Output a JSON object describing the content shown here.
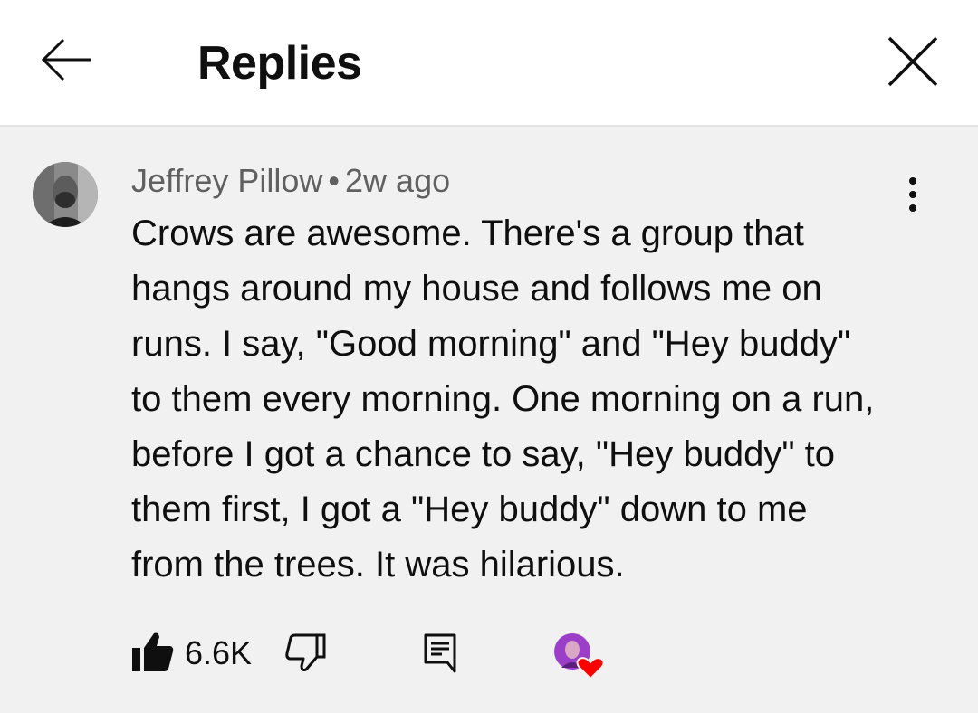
{
  "header": {
    "title": "Replies",
    "back_icon": "arrow-left-icon",
    "close_icon": "close-icon"
  },
  "comment": {
    "author": "Jeffrey Pillow",
    "separator": "•",
    "time": "2w ago",
    "text_lines": [
      "Crows are awesome. There's a group that",
      "hangs around my house and follows me on",
      "runs. I say, \"Good morning\" and \"Hey buddy\"",
      "to them every morning. One morning on a run,",
      "before I got a chance to say, \"Hey buddy\" to",
      "them first, I got a \"Hey buddy\" down to me",
      "from the trees. It was hilarious."
    ],
    "menu_icon": "more-vertical-icon"
  },
  "actions": {
    "like_count": "6.6K",
    "like_icon": "thumbs-up-filled-icon",
    "dislike_icon": "thumbs-down-icon",
    "reply_icon": "comment-icon",
    "creator_heart_icon": "creator-heart-icon"
  },
  "colors": {
    "background": "#f1f1f1",
    "header_bg": "#ffffff",
    "text_primary": "#0f0f0f",
    "text_secondary": "#606060",
    "heart": "#ff0000",
    "avatar_purple": "#9b3fc8"
  }
}
